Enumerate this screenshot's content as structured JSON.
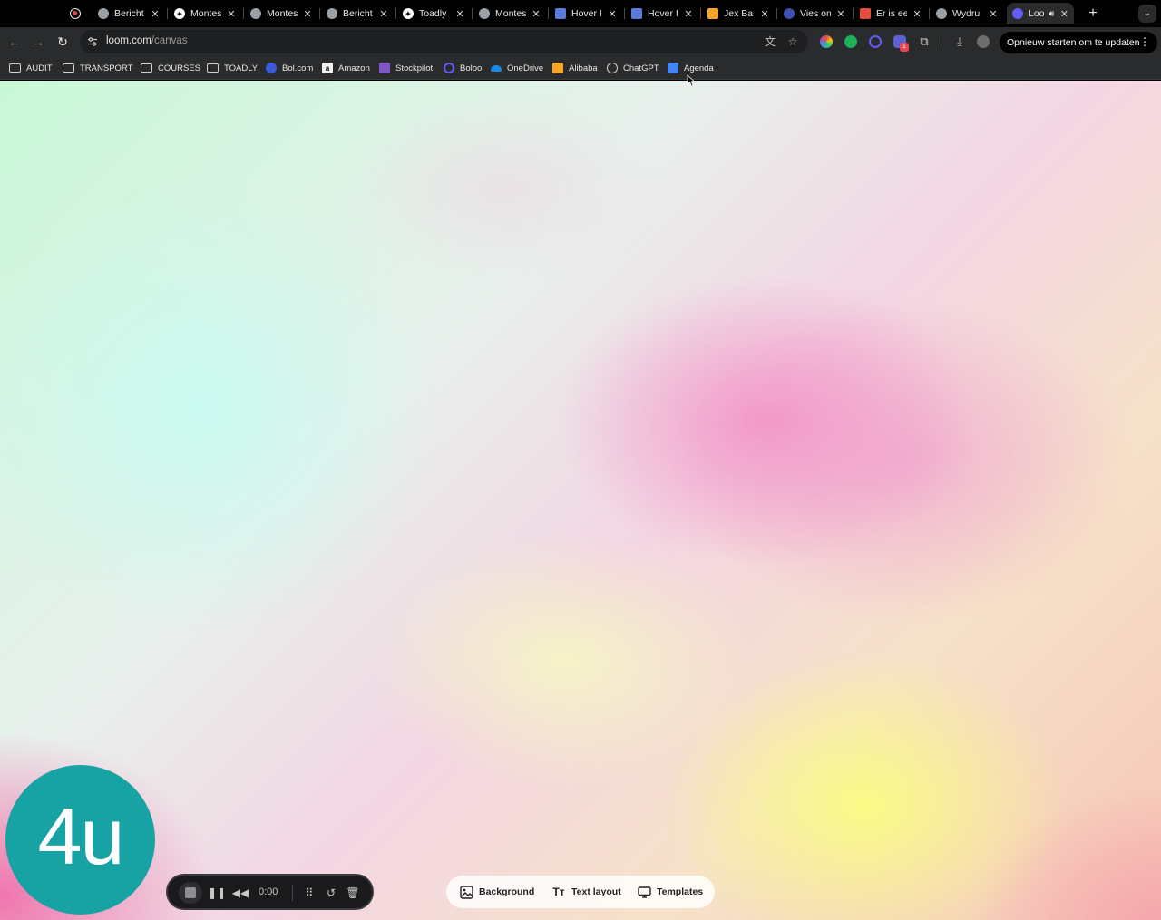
{
  "browser": {
    "tabs": [
      {
        "title": "Bericht",
        "icon": "globe-icon",
        "color": "#9aa0a6"
      },
      {
        "title": "Montes",
        "icon": "montes-icon",
        "color": "#ffffff"
      },
      {
        "title": "Montes",
        "icon": "globe-icon",
        "color": "#9aa0a6"
      },
      {
        "title": "Bericht",
        "icon": "globe-icon",
        "color": "#9aa0a6"
      },
      {
        "title": "Toadly",
        "icon": "toadly-icon",
        "color": "#ffffff"
      },
      {
        "title": "Montes",
        "icon": "globe-icon",
        "color": "#9aa0a6"
      },
      {
        "title": "Hover I",
        "icon": "hover-icon",
        "color": "#5b7bd8"
      },
      {
        "title": "Hover I",
        "icon": "hover-icon",
        "color": "#5b7bd8"
      },
      {
        "title": "Jex Ba",
        "icon": "jex-icon",
        "color": "#f4a62a"
      },
      {
        "title": "Vies on",
        "icon": "vies-icon",
        "color": "#3f51b5"
      },
      {
        "title": "Er is ee",
        "icon": "gmail-icon",
        "color": "#e74c3c"
      },
      {
        "title": "Wydru",
        "icon": "globe-icon",
        "color": "#9aa0a6"
      }
    ],
    "active_tab": {
      "title": "Loo",
      "icon": "loom-icon",
      "color": "#625df5"
    },
    "address": {
      "host": "loom.com",
      "path": "/canvas"
    },
    "update_button": "Opnieuw starten om te updaten",
    "extension_badge": "1"
  },
  "bookmarks": [
    {
      "label": "AUDIT",
      "icon": "folder-icon"
    },
    {
      "label": "TRANSPORT",
      "icon": "folder-icon"
    },
    {
      "label": "COURSES",
      "icon": "folder-icon"
    },
    {
      "label": "TOADLY",
      "icon": "folder-icon"
    },
    {
      "label": "Bol.com",
      "icon": "bol-icon"
    },
    {
      "label": "Amazon",
      "icon": "amazon-icon"
    },
    {
      "label": "Stockpilot",
      "icon": "stockpilot-icon"
    },
    {
      "label": "Boloo",
      "icon": "boloo-icon"
    },
    {
      "label": "OneDrive",
      "icon": "onedrive-icon"
    },
    {
      "label": "Alibaba",
      "icon": "alibaba-icon"
    },
    {
      "label": "ChatGPT",
      "icon": "chatgpt-icon"
    },
    {
      "label": "Agenda",
      "icon": "calendar-icon"
    }
  ],
  "avatar": {
    "initials": "4u",
    "color": "#17a2a4"
  },
  "recording": {
    "timer": "0:00"
  },
  "canvas_options": [
    {
      "label": "Background",
      "icon": "image-icon"
    },
    {
      "label": "Text layout",
      "icon": "text-icon"
    },
    {
      "label": "Templates",
      "icon": "monitor-icon"
    }
  ]
}
